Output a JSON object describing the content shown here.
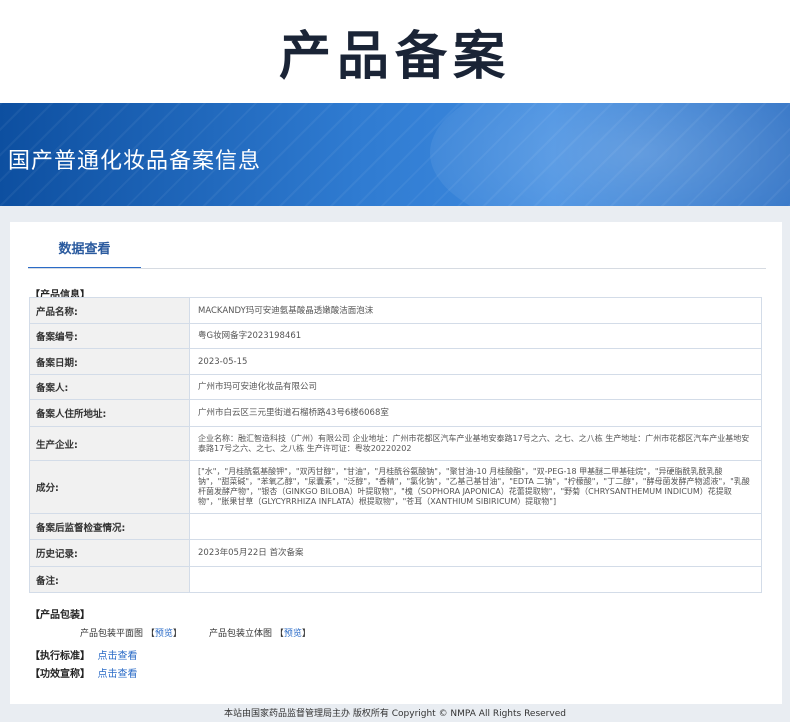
{
  "page_title": "产品备案",
  "banner_title": "国产普通化妆品备案信息",
  "tab_label": "数据查看",
  "sections": {
    "product_info": "【产品信息】",
    "product_package": "【产品包装】",
    "standard": "【执行标准】",
    "efficacy": "【功效宣称】"
  },
  "info_rows": [
    {
      "label": "产品名称:",
      "value": "MACKANDY玛可安迪氨基酸晶透嫩酸洁面泡沫"
    },
    {
      "label": "备案编号:",
      "value": "粤G妆网备字2023198461"
    },
    {
      "label": "备案日期:",
      "value": "2023-05-15"
    },
    {
      "label": "备案人:",
      "value": "广州市玛可安迪化妆品有限公司"
    },
    {
      "label": "备案人住所地址:",
      "value": "广州市白云区三元里街道石榴桥路43号6楼6068室"
    },
    {
      "label": "生产企业:",
      "value": "企业名称：融汇智造科技（广州）有限公司 企业地址：广州市花都区汽车产业基地安泰路17号之六、之七、之八栋 生产地址：广州市花都区汽车产业基地安泰路17号之六、之七、之八栋 生产许可证：粤妆20220202"
    },
    {
      "label": "成分:",
      "value": "[\"水\"，\"月桂酰氨基酸钾\"，\"双丙甘醇\"，\"甘油\"，\"月桂酰谷氨酸钠\"，\"聚甘油-10 月桂酸酯\"，\"双-PEG-18 甲基醚二甲基硅烷\"，\"异硬脂酰乳酰乳酸钠\"，\"甜菜碱\"，\"苯氧乙醇\"，\"尿囊素\"，\"泛醇\"，\"香精\"，\"氯化钠\"，\"乙基己基甘油\"，\"EDTA 二钠\"，\"柠檬酸\"，\"丁二醇\"，\"酵母菌发酵产物滤液\"，\"乳酸杆菌发酵产物\"，\"银杏（GINKGO BILOBA）叶提取物\"，\"槐（SOPHORA JAPONICA）花蕾提取物\"，\"野菊（CHRYSANTHEMUM INDICUM）花提取物\"，\"胀果甘草（GLYCYRRHIZA INFLATA）根提取物\"，\"苍耳（XANTHIUM SIBIRICUM）提取物\"]"
    },
    {
      "label": "备案后监督检查情况:",
      "value": ""
    },
    {
      "label": "历史记录:",
      "value": "2023年05月22日 首次备案"
    },
    {
      "label": "备注:",
      "value": ""
    }
  ],
  "package": {
    "flat_label": "产品包装平面图",
    "solid_label": "产品包装立体图",
    "preview": "预览",
    "bracket_open": "【",
    "bracket_close": "】"
  },
  "click_view": "点击查看",
  "footer": "本站由国家药品监督管理局主办 版权所有 Copyright © NMPA All Rights Reserved"
}
